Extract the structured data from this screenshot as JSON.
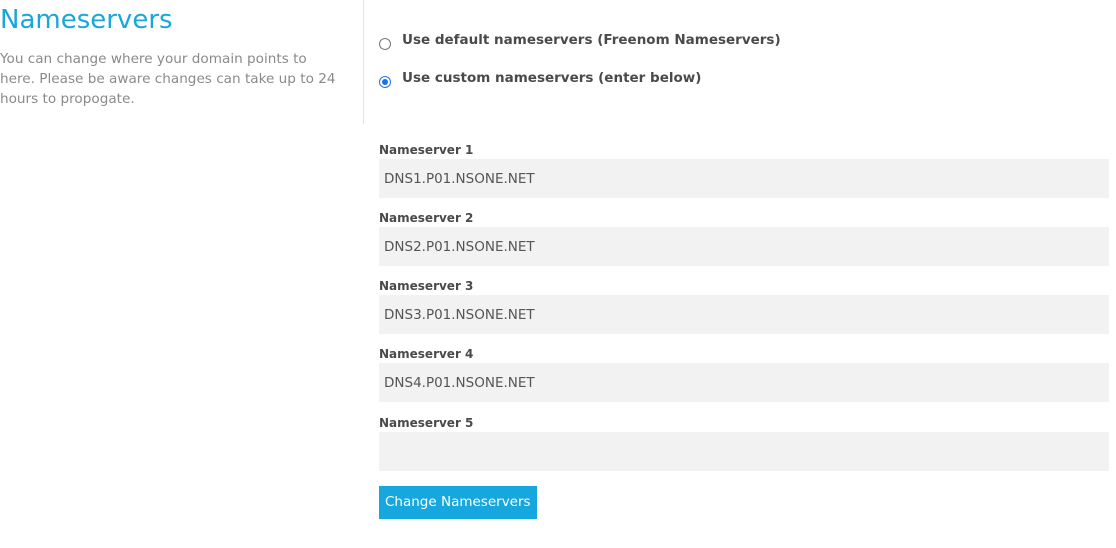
{
  "header": {
    "title": "Nameservers",
    "description": "You can change where your domain points to here. Please be aware changes can take up to 24 hours to propogate."
  },
  "options": [
    {
      "label": "Use default nameservers (Freenom Nameservers)",
      "checked": false
    },
    {
      "label": "Use custom nameservers (enter below)",
      "checked": true
    }
  ],
  "nameservers": [
    {
      "label": "Nameserver 1",
      "value": "DNS1.P01.NSONE.NET"
    },
    {
      "label": "Nameserver 2",
      "value": "DNS2.P01.NSONE.NET"
    },
    {
      "label": "Nameserver 3",
      "value": "DNS3.P01.NSONE.NET"
    },
    {
      "label": "Nameserver 4",
      "value": "DNS4.P01.NSONE.NET"
    },
    {
      "label": "Nameserver 5",
      "value": ""
    }
  ],
  "submit": {
    "label": "Change Nameservers"
  },
  "colors": {
    "accent": "#19a7d9",
    "button": "#15a7dd",
    "input_bg": "#f2f2f2",
    "radio_checked": "#1a73e8"
  }
}
